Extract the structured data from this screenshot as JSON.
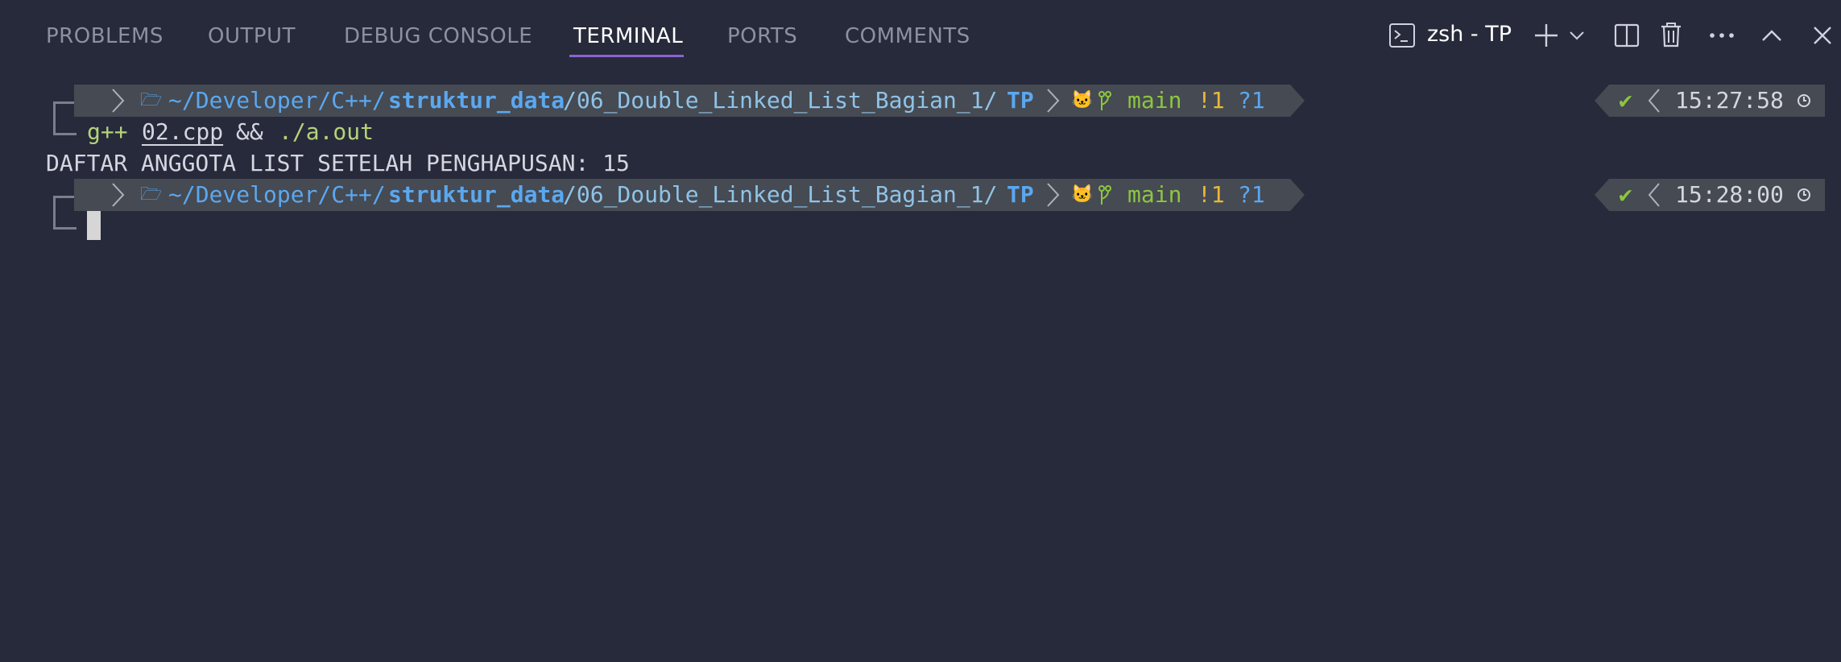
{
  "tabs": [
    {
      "label": "PROBLEMS",
      "active": false
    },
    {
      "label": "OUTPUT",
      "active": false
    },
    {
      "label": "DEBUG CONSOLE",
      "active": false
    },
    {
      "label": "TERMINAL",
      "active": true
    },
    {
      "label": "PORTS",
      "active": false
    },
    {
      "label": "COMMENTS",
      "active": false
    }
  ],
  "terminal_instance": {
    "name": "zsh - TP"
  },
  "colors": {
    "accent": "#8a63d2",
    "path_home": "#5aa8f0",
    "path_bold": "#5aa8f0",
    "path_dim": "#8fc3e8",
    "git_green": "#8cc63f",
    "git_yellow": "#e7b83c",
    "git_blue": "#5aa8f0",
    "command_green": "#b5d27a",
    "ok_green": "#8cc63f"
  },
  "prompts": [
    {
      "path_prefix": "~/Developer/C++/",
      "path_bold": "struktur_data",
      "path_mid": "/06_Double_Linked_List_Bagian_1/",
      "path_last": "TP",
      "branch": "main",
      "modified": "!1",
      "untracked": "?1",
      "status_icon": "✔",
      "time": "15:27:58"
    },
    {
      "path_prefix": "~/Developer/C++/",
      "path_bold": "struktur_data",
      "path_mid": "/06_Double_Linked_List_Bagian_1/",
      "path_last": "TP",
      "branch": "main",
      "modified": "!1",
      "untracked": "?1",
      "status_icon": "✔",
      "time": "15:28:00"
    }
  ],
  "command": {
    "program": "g++",
    "file": "02.cpp",
    "op": "&&",
    "run": "./a.out"
  },
  "output_line": "DAFTAR ANGGOTA LIST SETELAH PENGHAPUSAN: 15",
  "icons": {
    "terminal": "terminal-icon",
    "plus": "plus-icon",
    "chevron": "chevron-down-icon",
    "split": "split-editor-icon",
    "trash": "trash-icon",
    "more": "more-icon",
    "maximize": "chevron-up-icon",
    "close": "close-icon",
    "apple": "apple-icon",
    "folder": "folder-icon",
    "github": "github-icon",
    "branch": "git-branch-icon",
    "clock": "clock-icon"
  }
}
